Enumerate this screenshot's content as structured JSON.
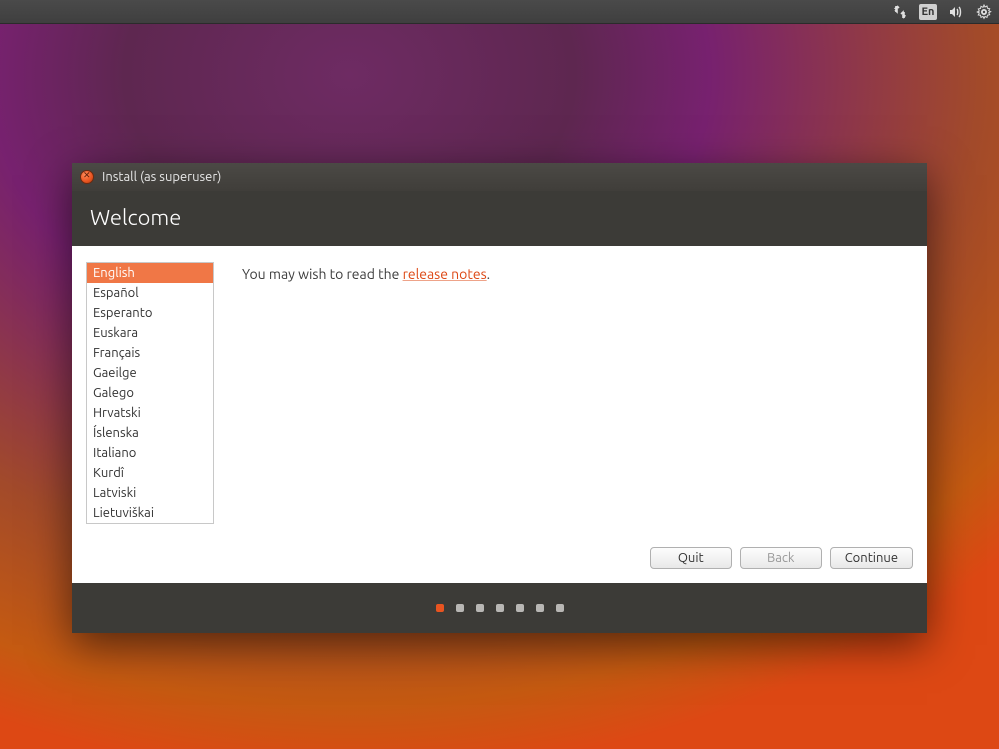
{
  "menubar": {
    "lang_indicator": "En"
  },
  "window": {
    "title": "Install (as superuser)"
  },
  "page": {
    "heading": "Welcome",
    "note_prefix": "You may wish to read the ",
    "note_link": "release notes",
    "note_suffix": "."
  },
  "languages": [
    "English",
    "Español",
    "Esperanto",
    "Euskara",
    "Français",
    "Gaeilge",
    "Galego",
    "Hrvatski",
    "Íslenska",
    "Italiano",
    "Kurdî",
    "Latviski",
    "Lietuviškai"
  ],
  "selected_language_index": 0,
  "buttons": {
    "quit": "Quit",
    "back": "Back",
    "continue": "Continue"
  },
  "progress": {
    "total": 7,
    "current": 1
  }
}
